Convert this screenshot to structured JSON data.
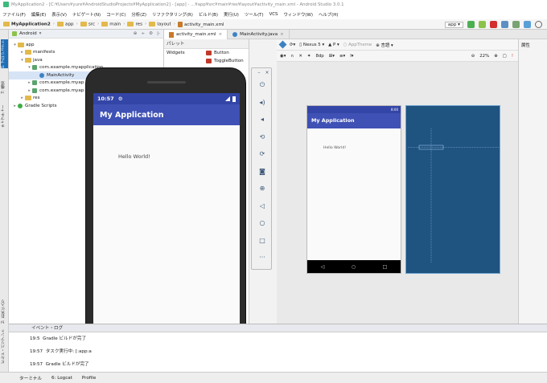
{
  "window": {
    "title": "MyApplication2 - [C:¥Users¥yure¥AndroidStudioProjects¥MyApplication2] - [app] - ...¥app¥src¥main¥res¥layout¥activity_main.xml - Android Studio 3.0.1"
  },
  "menu": [
    "ファイル(F)",
    "編集(E)",
    "表示(V)",
    "ナビゲート(N)",
    "コード(C)",
    "分析(Z)",
    "リファクタリング(R)",
    "ビルド(B)",
    "実行(U)",
    "ツール(T)",
    "VCS",
    "ウィンドウ(W)",
    "ヘルプ(H)"
  ],
  "breadcrumb": [
    "MyApplication2",
    "app",
    "src",
    "main",
    "res",
    "layout",
    "activity_main.xml"
  ],
  "toolbar": {
    "device_label": "app"
  },
  "project": {
    "view_selector": "Android",
    "tree": [
      {
        "label": "app",
        "indent": 0,
        "type": "folder",
        "expanded": true
      },
      {
        "label": "manifests",
        "indent": 1,
        "type": "folder",
        "expanded": false
      },
      {
        "label": "java",
        "indent": 1,
        "type": "folder",
        "expanded": true
      },
      {
        "label": "com.example.myapplication",
        "indent": 2,
        "type": "package",
        "expanded": true
      },
      {
        "label": "MainActivity",
        "indent": 3,
        "type": "class",
        "selected": true
      },
      {
        "label": "com.example.myap",
        "indent": 2,
        "type": "package",
        "expanded": false
      },
      {
        "label": "com.example.myap",
        "indent": 2,
        "type": "package",
        "expanded": false
      },
      {
        "label": "res",
        "indent": 1,
        "type": "folder",
        "expanded": false
      },
      {
        "label": "Gradle Scripts",
        "indent": 0,
        "type": "gradle",
        "expanded": false
      }
    ]
  },
  "side_tabs": {
    "project": "1: プロジェクト",
    "structure": "7: 構造",
    "captures": "キャプチャー",
    "favorites": "2: お気に入り",
    "build_variants": "ビルド・バリアント"
  },
  "editor_tabs": [
    {
      "label": "activity_main.xml",
      "active": true,
      "kind": "xml"
    },
    {
      "label": "MainActivity.java",
      "active": false,
      "kind": "java"
    }
  ],
  "palette": {
    "title": "パレット",
    "categories": [
      "Widgets"
    ],
    "items": [
      "Button",
      "ToggleButton"
    ]
  },
  "design": {
    "device": "Nexus 5",
    "api": "P",
    "theme": "AppTheme",
    "language": "言語",
    "zoom": "22%",
    "attributes_title": "属性",
    "preview_app_title": "My Application",
    "preview_hello": "Hello World!",
    "preview_time": "8:00"
  },
  "emulator": {
    "time": "10:57",
    "app_title": "My Application",
    "hello": "Hello World!"
  },
  "event_log": {
    "title": "イベント・ログ",
    "rows": [
      {
        "time": "19:5",
        "text": "Gradle ビルドが完了"
      },
      {
        "time": "19:57",
        "text": "タスク実行中: [:app:a"
      },
      {
        "time": "19:57",
        "text": "Gradle ビルドが完了"
      }
    ]
  },
  "bottom_tabs": [
    "ターミナル",
    "6: Logcat",
    "Profile"
  ],
  "colors": {
    "primary": "#3f51b5",
    "primary_dark": "#3345a6",
    "blueprint": "#1f5380"
  }
}
